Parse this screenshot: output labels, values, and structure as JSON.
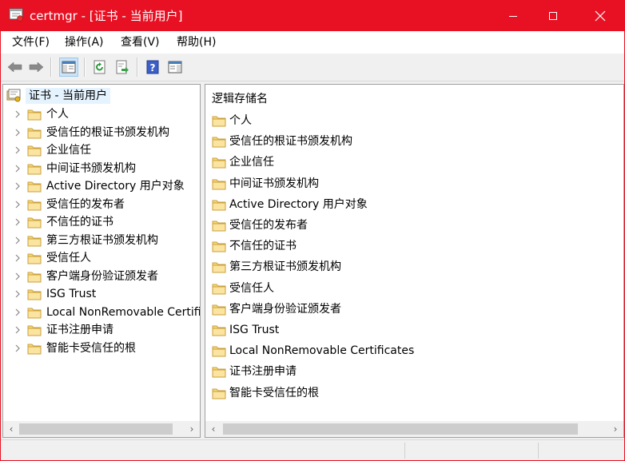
{
  "window": {
    "title": "certmgr - [证书 - 当前用户]",
    "accent_color": "#e81123"
  },
  "menu": [
    "文件(F)",
    "操作(A)",
    "查看(V)",
    "帮助(H)"
  ],
  "toolbar": {
    "icons": [
      "back-arrow-icon",
      "forward-arrow-icon",
      "show-hide-console-tree-icon",
      "refresh-icon",
      "export-list-icon",
      "help-icon",
      "properties-pane-icon"
    ]
  },
  "tree": {
    "root": "证书 - 当前用户",
    "items": [
      "个人",
      "受信任的根证书颁发机构",
      "企业信任",
      "中间证书颁发机构",
      "Active Directory 用户对象",
      "受信任的发布者",
      "不信任的证书",
      "第三方根证书颁发机构",
      "受信任人",
      "客户端身份验证颁发者",
      "ISG Trust",
      "Local NonRemovable Certifi",
      "证书注册申请",
      "智能卡受信任的根"
    ]
  },
  "list": {
    "header": "逻辑存储名",
    "items": [
      "个人",
      "受信任的根证书颁发机构",
      "企业信任",
      "中间证书颁发机构",
      "Active Directory 用户对象",
      "受信任的发布者",
      "不信任的证书",
      "第三方根证书颁发机构",
      "受信任人",
      "客户端身份验证颁发者",
      "ISG Trust",
      "Local NonRemovable Certificates",
      "证书注册申请",
      "智能卡受信任的根"
    ]
  },
  "scrollbar": {
    "left_arrow": "‹",
    "right_arrow": "›"
  }
}
